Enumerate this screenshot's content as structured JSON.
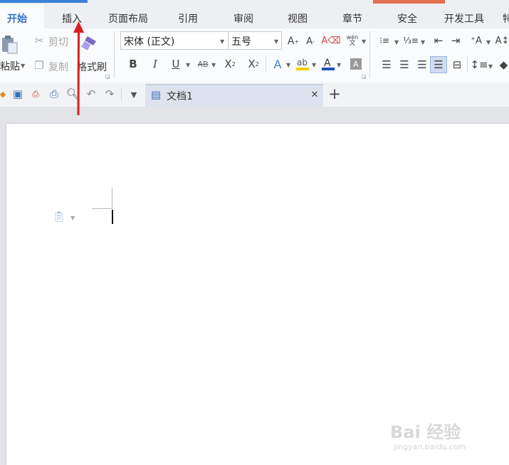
{
  "menu": {
    "tabs": [
      {
        "label": "开始"
      },
      {
        "label": "插入"
      },
      {
        "label": "页面布局"
      },
      {
        "label": "引用"
      },
      {
        "label": "审阅"
      },
      {
        "label": "视图"
      },
      {
        "label": "章节"
      },
      {
        "label": "安全"
      },
      {
        "label": "开发工具"
      },
      {
        "label": "特"
      }
    ]
  },
  "clipboard": {
    "paste_label": "粘贴",
    "cut_label": "剪切",
    "copy_label": "复制",
    "format_painter_label": "格式刷"
  },
  "font": {
    "family": "宋体 (正文)",
    "size": "五号"
  },
  "document": {
    "tab_title": "文档1"
  },
  "watermark": {
    "text": "Bai 经验",
    "sub": "jingyan.baidu.com"
  },
  "colors": {
    "accent_blue": "#3a82d8",
    "accent_orange": "#e07050",
    "annotation_arrow": "#d62020",
    "font_color_bar": "#1f4fbf",
    "highlight_bar": "#f0d000"
  }
}
